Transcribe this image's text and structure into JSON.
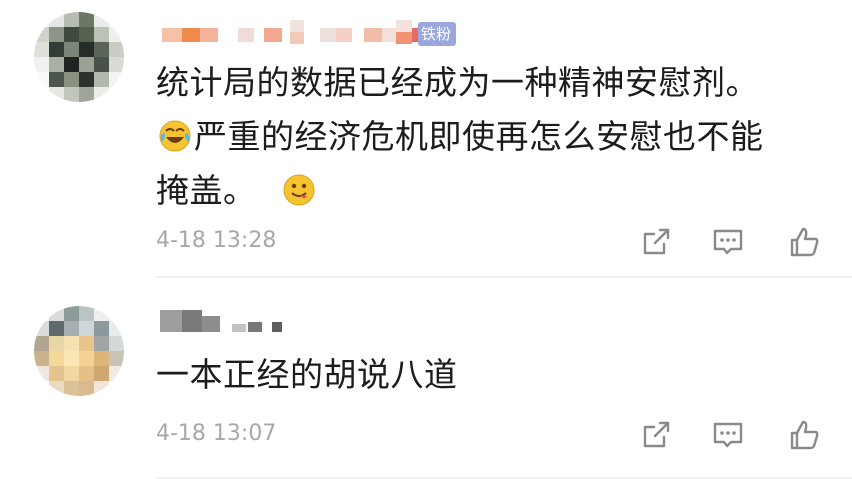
{
  "comments": [
    {
      "badge": "铁粉",
      "text_line1": "统计局的数据已经成为一种精神安慰剂。",
      "text_line2": "严重的经济危机即使再怎么安慰也不能",
      "text_line3_prefix": "掩盖。",
      "emojis": [
        "laughing-crying-emoji",
        "tongue-out-emoji"
      ],
      "time": "4-18 13:28"
    },
    {
      "text": "一本正经的胡说八道",
      "time": "4-18 13:07"
    }
  ],
  "icons": {
    "forward": "share-icon",
    "comment": "comment-icon",
    "like": "thumbs-up-icon"
  },
  "colors": {
    "text": "#1c1c1c",
    "time": "#a8a8a8",
    "icon": "#8a8a8a",
    "badge": "#9aa7de"
  }
}
